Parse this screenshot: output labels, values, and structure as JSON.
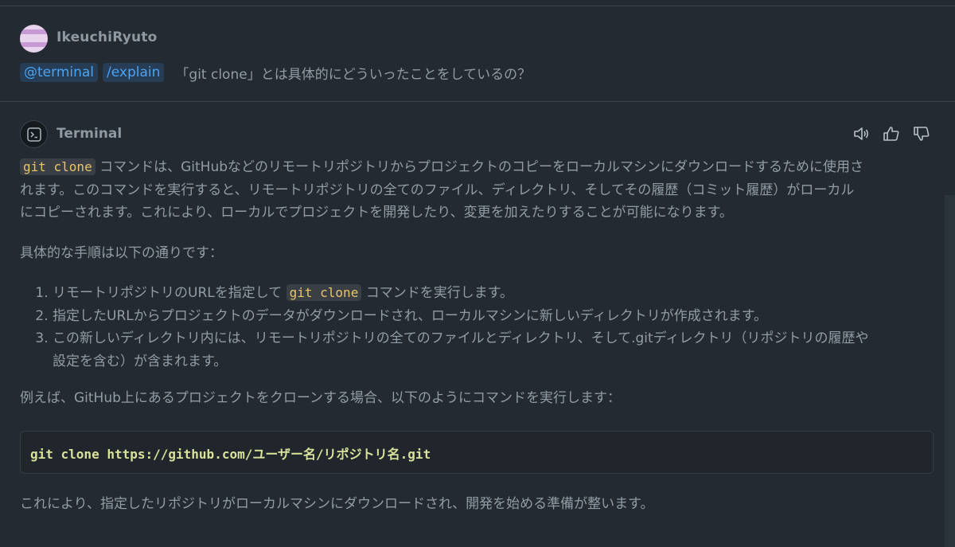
{
  "user": {
    "name": "IkeuchiRyuto",
    "agent_tag": "@terminal",
    "command_tag": "/explain",
    "question": "「git clone」とは具体的にどういったことをしているの？"
  },
  "bot": {
    "name": "Terminal",
    "icon": "terminal-icon",
    "actions": [
      "speaker-icon",
      "thumbs-up-icon",
      "thumbs-down-icon"
    ]
  },
  "answer": {
    "intro_code": "git clone",
    "intro_line1": " コマンドは、GitHubなどのリモートリポジトリからプロジェクトのコピーをローカルマシンにダウンロードするために使用さ",
    "intro_line2": "れます。このコマンドを実行すると、リモートリポジトリの全てのファイル、ディレクトリ、そしてその履歴（コミット履歴）がローカル",
    "intro_line3": "にコピーされます。これにより、ローカルでプロジェクトを開発したり、変更を加えたりすることが可能になります。",
    "steps_heading": "具体的な手順は以下の通りです：",
    "step1_before": "リモートリポジトリのURLを指定して ",
    "step1_code": "git clone",
    "step1_after": " コマンドを実行します。",
    "step2": "指定したURLからプロジェクトのデータがダウンロードされ、ローカルマシンに新しいディレクトリが作成されます。",
    "step3_line1": "この新しいディレクトリ内には、リモートリポジトリの全てのファイルとディレクトリ、そして.gitディレクトリ（リポジトリの履歴や",
    "step3_line2": "設定を含む）が含まれます。",
    "example_heading": "例えば、GitHub上にあるプロジェクトをクローンする場合、以下のようにコマンドを実行します：",
    "code_block": "git clone https://github.com/ユーザー名/リポジトリ名.git",
    "closing": "これにより、指定したリポジトリがローカルマシンにダウンロードされ、開発を始める準備が整います。"
  },
  "colors": {
    "background": "#232a31",
    "tag_text": "#4ba3f2",
    "inline_code": "#e9c46a",
    "code_block_text": "#d8e29a"
  }
}
